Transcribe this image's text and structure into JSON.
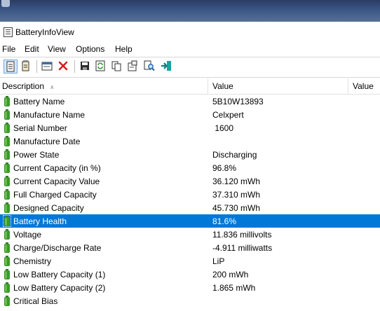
{
  "window": {
    "title": "BatteryInfoView"
  },
  "menu": [
    "File",
    "Edit",
    "View",
    "Options",
    "Help"
  ],
  "toolbar": [
    "html-report-icon",
    "text-report-icon",
    "properties-icon",
    "delete-icon",
    "save-icon",
    "refresh-icon",
    "copy-icon",
    "properties-page-icon",
    "find-icon",
    "exit-icon"
  ],
  "columns": {
    "description": "Description",
    "value1": "Value",
    "value2": "Value"
  },
  "rows": [
    {
      "label": "Battery Name",
      "value": "5B10W13893"
    },
    {
      "label": "Manufacture Name",
      "value": "Celxpert"
    },
    {
      "label": "Serial Number",
      "value": " 1600"
    },
    {
      "label": "Manufacture Date",
      "value": ""
    },
    {
      "label": "Power State",
      "value": "Discharging"
    },
    {
      "label": "Current Capacity (in %)",
      "value": "96.8%"
    },
    {
      "label": "Current Capacity Value",
      "value": "36.120 mWh"
    },
    {
      "label": "Full Charged Capacity",
      "value": "37.310 mWh"
    },
    {
      "label": "Designed Capacity",
      "value": "45.730 mWh"
    },
    {
      "label": "Battery Health",
      "value": "81.6%"
    },
    {
      "label": "Voltage",
      "value": "11.836 millivolts"
    },
    {
      "label": "Charge/Discharge Rate",
      "value": "-4.911 milliwatts"
    },
    {
      "label": "Chemistry",
      "value": "LiP"
    },
    {
      "label": "Low Battery Capacity (1)",
      "value": "200 mWh"
    },
    {
      "label": "Low Battery Capacity (2)",
      "value": "1.865 mWh"
    },
    {
      "label": "Critical Bias",
      "value": ""
    }
  ],
  "selected_row": "Battery Health",
  "colors": {
    "selection": "#0078d7",
    "battery_green": "#3c9a2a"
  }
}
